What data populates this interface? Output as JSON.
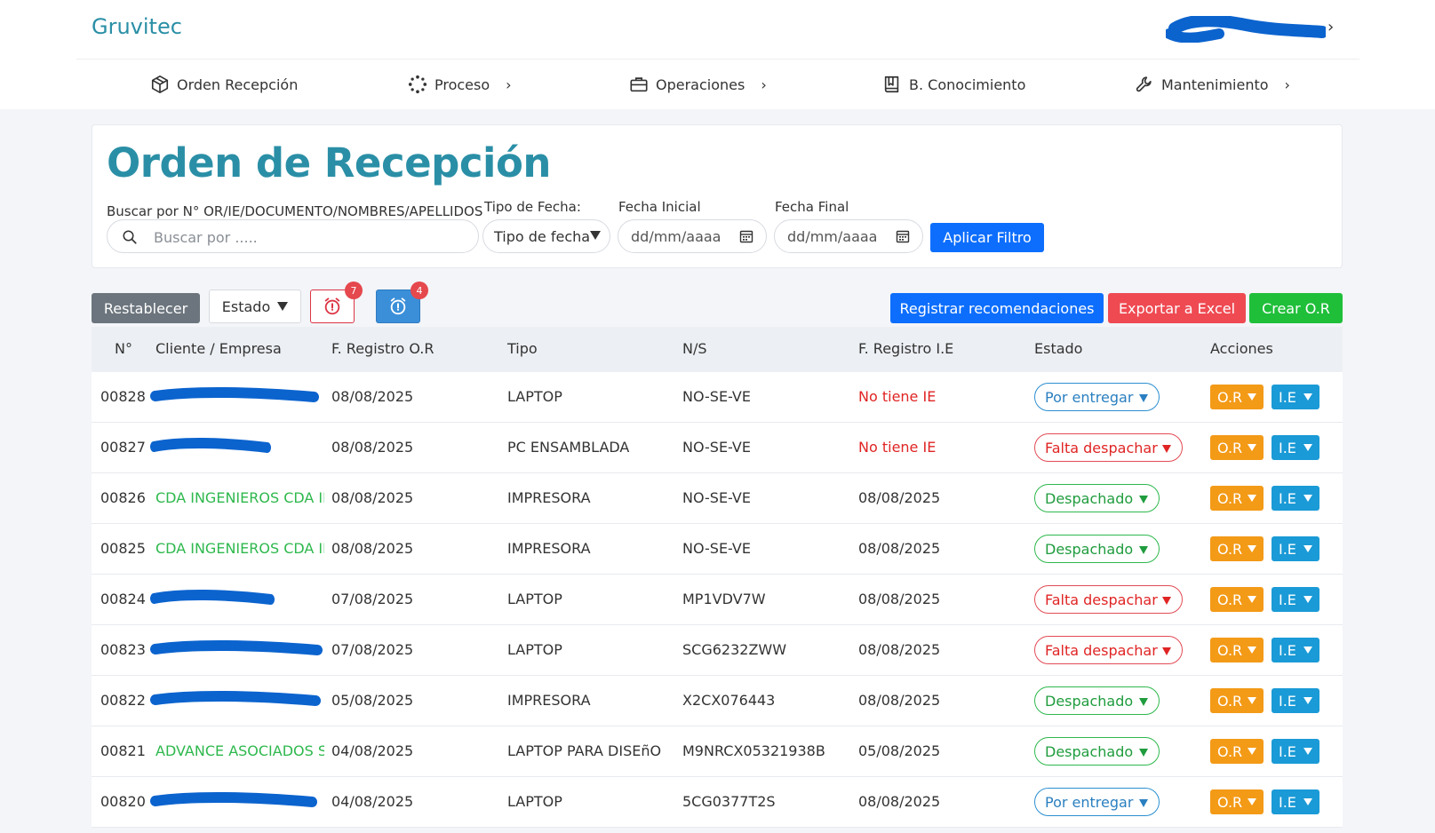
{
  "app": {
    "brand": "Gruvitec"
  },
  "nav": [
    {
      "label": "Orden Recepción",
      "icon": "box-icon",
      "chevron": false
    },
    {
      "label": "Proceso",
      "icon": "spinner-icon",
      "chevron": true
    },
    {
      "label": "Operaciones",
      "icon": "briefcase-icon",
      "chevron": true
    },
    {
      "label": "B. Conocimiento",
      "icon": "book-icon",
      "chevron": false
    },
    {
      "label": "Mantenimiento",
      "icon": "wrench-icon",
      "chevron": true
    }
  ],
  "page": {
    "title": "Orden de Recepción"
  },
  "filters": {
    "search_label": "Buscar por N° OR/IE/DOCUMENTO/NOMBRES/APELLIDOS",
    "search_placeholder": "Buscar por .....",
    "date_type_label": "Tipo de Fecha:",
    "date_type_value": "Tipo de fecha",
    "start_label": "Fecha Inicial",
    "start_placeholder": "dd/mm/aaaa",
    "end_label": "Fecha Final",
    "end_placeholder": "dd/mm/aaaa",
    "apply": "Aplicar Filtro"
  },
  "toolbar": {
    "reset": "Restablecer",
    "estado": "Estado",
    "alarm_red_count": "7",
    "alarm_blue_count": "4",
    "register": "Registrar recomendaciones",
    "export": "Exportar a Excel",
    "create": "Crear O.R"
  },
  "colors": {
    "brand": "#2a8fa6",
    "primary": "#0d6efd",
    "danger": "#ef4a52",
    "success": "#1fbf3a",
    "or": "#f39a17",
    "ie": "#1a9ad6"
  },
  "table": {
    "headers": [
      "N°",
      "Cliente / Empresa",
      "F. Registro O.R",
      "Tipo",
      "N/S",
      "F. Registro I.E",
      "Estado",
      "Acciones"
    ],
    "rows": [
      {
        "num": "00828",
        "client": "",
        "fecha_or": "08/08/2025",
        "tipo": "LAPTOP",
        "ns": "NO-SE-VE",
        "fecha_ie": "No tiene IE",
        "estado": "Por entregar",
        "or": "O.R",
        "ie": "I.E"
      },
      {
        "num": "00827",
        "client": "",
        "fecha_or": "08/08/2025",
        "tipo": "PC ENSAMBLADA",
        "ns": "NO-SE-VE",
        "fecha_ie": "No tiene IE",
        "estado": "Falta despachar",
        "or": "O.R",
        "ie": "I.E"
      },
      {
        "num": "00826",
        "client": "CDA INGENIEROS CDA INGENIEROS",
        "fecha_or": "08/08/2025",
        "tipo": "IMPRESORA",
        "ns": "NO-SE-VE",
        "fecha_ie": "08/08/2025",
        "estado": "Despachado",
        "or": "O.R",
        "ie": "I.E"
      },
      {
        "num": "00825",
        "client": "CDA INGENIEROS CDA INGENIEROS",
        "fecha_or": "08/08/2025",
        "tipo": "IMPRESORA",
        "ns": "NO-SE-VE",
        "fecha_ie": "08/08/2025",
        "estado": "Despachado",
        "or": "O.R",
        "ie": "I.E"
      },
      {
        "num": "00824",
        "client": "",
        "fecha_or": "07/08/2025",
        "tipo": "LAPTOP",
        "ns": "MP1VDV7W",
        "fecha_ie": "08/08/2025",
        "estado": "Falta despachar",
        "or": "O.R",
        "ie": "I.E"
      },
      {
        "num": "00823",
        "client": "",
        "fecha_or": "07/08/2025",
        "tipo": "LAPTOP",
        "ns": "SCG6232ZWW",
        "fecha_ie": "08/08/2025",
        "estado": "Falta despachar",
        "or": "O.R",
        "ie": "I.E"
      },
      {
        "num": "00822",
        "client": "",
        "fecha_or": "05/08/2025",
        "tipo": "IMPRESORA",
        "ns": "X2CX076443",
        "fecha_ie": "08/08/2025",
        "estado": "Despachado",
        "or": "O.R",
        "ie": "I.E"
      },
      {
        "num": "00821",
        "client": "ADVANCE ASOCIADOS SAC",
        "fecha_or": "04/08/2025",
        "tipo": "LAPTOP PARA DISEñO",
        "ns": "M9NRCX05321938B",
        "fecha_ie": "05/08/2025",
        "estado": "Despachado",
        "or": "O.R",
        "ie": "I.E"
      },
      {
        "num": "00820",
        "client": "",
        "fecha_or": "04/08/2025",
        "tipo": "LAPTOP",
        "ns": "5CG0377T2S",
        "fecha_ie": "08/08/2025",
        "estado": "Por entregar",
        "or": "O.R",
        "ie": "I.E"
      }
    ]
  }
}
